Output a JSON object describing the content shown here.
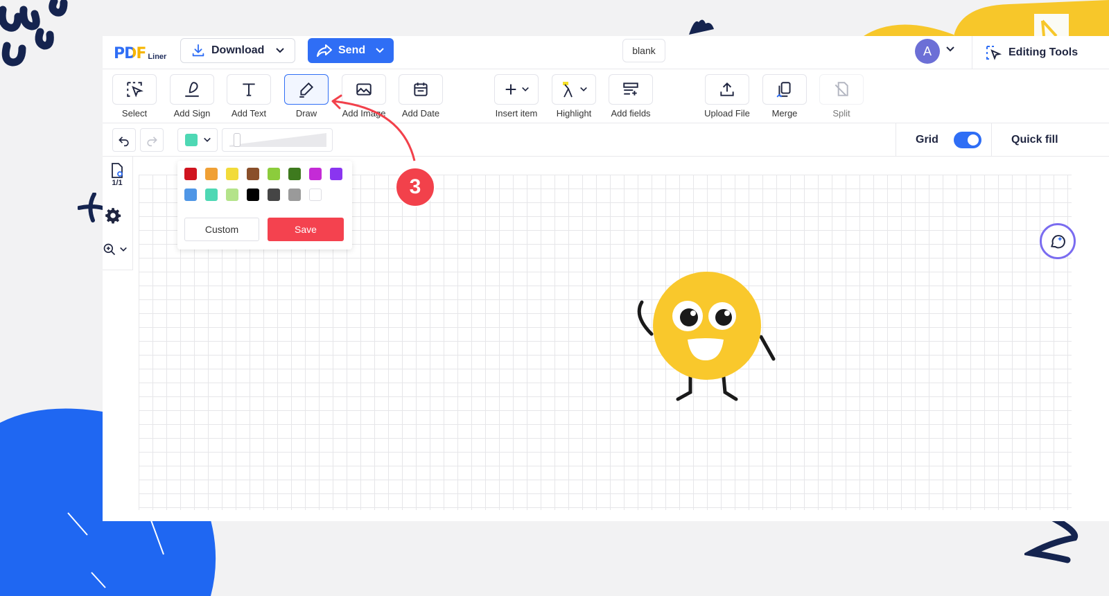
{
  "topbar": {
    "logo_main": "PDF",
    "logo_sub": "Liner",
    "download_label": "Download",
    "send_label": "Send",
    "doc_name": "blank",
    "avatar_initial": "A",
    "editing_tools_label": "Editing Tools"
  },
  "toolbar": {
    "tools": [
      {
        "label": "Select",
        "icon": "select-cursor-icon"
      },
      {
        "label": "Add Sign",
        "icon": "signature-pen-icon"
      },
      {
        "label": "Add Text",
        "icon": "text-t-icon"
      },
      {
        "label": "Draw",
        "icon": "pencil-icon",
        "active": true
      },
      {
        "label": "Add Image",
        "icon": "image-icon"
      },
      {
        "label": "Add Date",
        "icon": "calendar-icon"
      },
      {
        "label": "Insert item",
        "icon": "plus-icon"
      },
      {
        "label": "Highlight",
        "icon": "highlighter-icon"
      },
      {
        "label": "Add fields",
        "icon": "add-fields-icon"
      },
      {
        "label": "Upload File",
        "icon": "upload-icon"
      },
      {
        "label": "Merge",
        "icon": "merge-icon"
      },
      {
        "label": "Split",
        "icon": "split-icon",
        "disabled": true
      }
    ]
  },
  "subbar": {
    "selected_color": "#4ed8b4",
    "grid_label": "Grid",
    "grid_on": true,
    "quick_fill_label": "Quick fill"
  },
  "sidebar": {
    "page_count": "1/1"
  },
  "palette": {
    "colors": [
      "#d0141f",
      "#f0a035",
      "#f2db3a",
      "#8a4f2a",
      "#8ccc3c",
      "#3e7a1e",
      "#c42bd6",
      "#8a35f0",
      "#4f96e6",
      "#4ed8b4",
      "#b4e38a",
      "#000000",
      "#454545",
      "#9a9a9a",
      "#ffffff"
    ],
    "custom_label": "Custom",
    "save_label": "Save"
  },
  "annotation": {
    "step_number": "3"
  },
  "colors": {
    "brand_blue": "#2f6ef5",
    "save_red": "#f4424f",
    "step_red": "#f2414b"
  }
}
